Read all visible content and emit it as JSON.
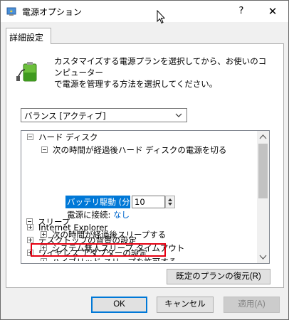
{
  "window": {
    "title": "電源オプション",
    "help_label": "?",
    "close_label": "✕"
  },
  "tab": {
    "label": "詳細設定"
  },
  "description": {
    "line1": "カスタマイズする電源プランを選択してから、お使いのコンピューター",
    "line2": "で電源を管理する方法を選択してください。"
  },
  "plan_select": {
    "value": "バランス [アクティブ]"
  },
  "tree": {
    "hard_disk": "ハード ディスク",
    "turn_off_after": "次の時間が経過後ハード ディスクの電源を切る",
    "on_battery_label": "バッテリ駆動 (分):",
    "on_battery_value": "10",
    "plugged_in_label": "電源に接続:",
    "plugged_in_value": "なし",
    "internet_explorer": "Internet Explorer",
    "desktop_background": "デスクトップの背景の設定",
    "wireless_adapter": "ワイヤレス アダプターの設定",
    "sleep": "スリープ",
    "sleep_after": "次の時間が経過後スリープする",
    "system_unattended_sleep": "システム無人スリープ タイムアウト",
    "hybrid_sleep": "ハイブリッド スリープを許可する"
  },
  "buttons": {
    "restore_defaults": "既定のプランの復元(R)",
    "ok": "OK",
    "cancel": "キャンセル",
    "apply": "適用(A)"
  },
  "colors": {
    "selection": "#0078d7",
    "highlight_border": "#e60012",
    "link": "#0066cc"
  }
}
